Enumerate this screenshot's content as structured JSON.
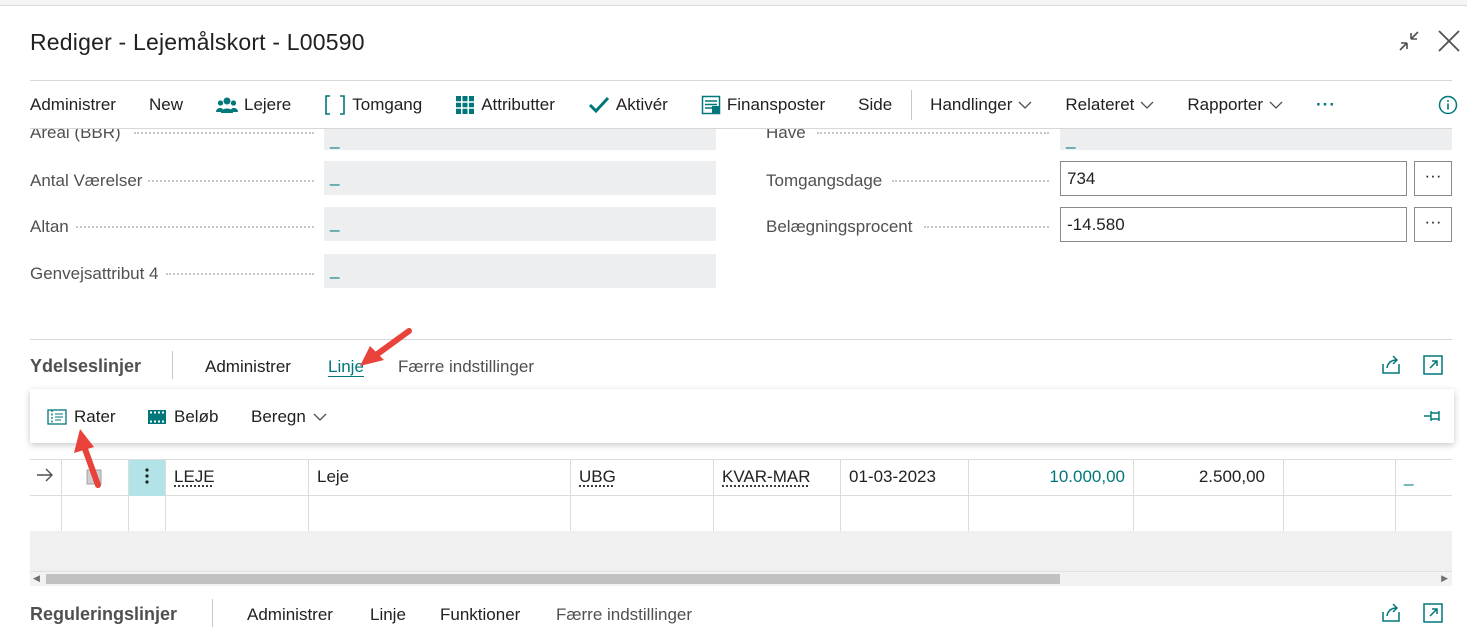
{
  "window": {
    "title": "Rediger - Lejemålskort - L00590"
  },
  "actions": [
    {
      "label": "Administrer",
      "icon": ""
    },
    {
      "label": "New",
      "icon": ""
    },
    {
      "label": "Lejere",
      "icon": "people-icon"
    },
    {
      "label": "Tomgang",
      "icon": "brackets-icon"
    },
    {
      "label": "Attributter",
      "icon": "grid-icon"
    },
    {
      "label": "Aktivér",
      "icon": "checkmark-icon"
    },
    {
      "label": "Finansposter",
      "icon": "ledger-icon"
    },
    {
      "label": "Side",
      "icon": ""
    }
  ],
  "menus": [
    {
      "label": "Handlinger"
    },
    {
      "label": "Relateret"
    },
    {
      "label": "Rapporter"
    }
  ],
  "more_label": "···",
  "fields_left": [
    {
      "label": "Areal (BBR)",
      "value": "_"
    },
    {
      "label": "Antal Værelser",
      "value": "_"
    },
    {
      "label": "Altan",
      "value": "_"
    },
    {
      "label": "Genvejsattribut 4",
      "value": "_"
    }
  ],
  "fields_right": [
    {
      "label": "Have",
      "value": "_"
    },
    {
      "label": "Tomgangsdage",
      "value": "734"
    },
    {
      "label": "Belægningsprocent",
      "value": "-14.580"
    }
  ],
  "lookup_label": "···",
  "section1": {
    "title": "Ydelseslinjer",
    "actions": [
      "Administrer",
      "Linje",
      "Færre indstillinger"
    ],
    "subactions": [
      "Rater",
      "Beløb",
      "Beregn"
    ]
  },
  "table": {
    "rows": [
      {
        "type": "LEJE",
        "description": "Leje",
        "terms": "UBG",
        "calendar": "KVAR-MAR",
        "start_date": "01-03-2023",
        "annual_amount": "10.000,00",
        "term_amount": "2.500,00",
        "end_date": "",
        "charge": "_"
      }
    ]
  },
  "section2": {
    "title": "Reguleringslinjer",
    "actions": [
      "Administrer",
      "Linje",
      "Funktioner",
      "Færre indstillinger"
    ]
  },
  "colors": {
    "accent": "#00777a",
    "annotation_arrow": "#e8423a",
    "menu_cell": "#b2e3e9"
  }
}
